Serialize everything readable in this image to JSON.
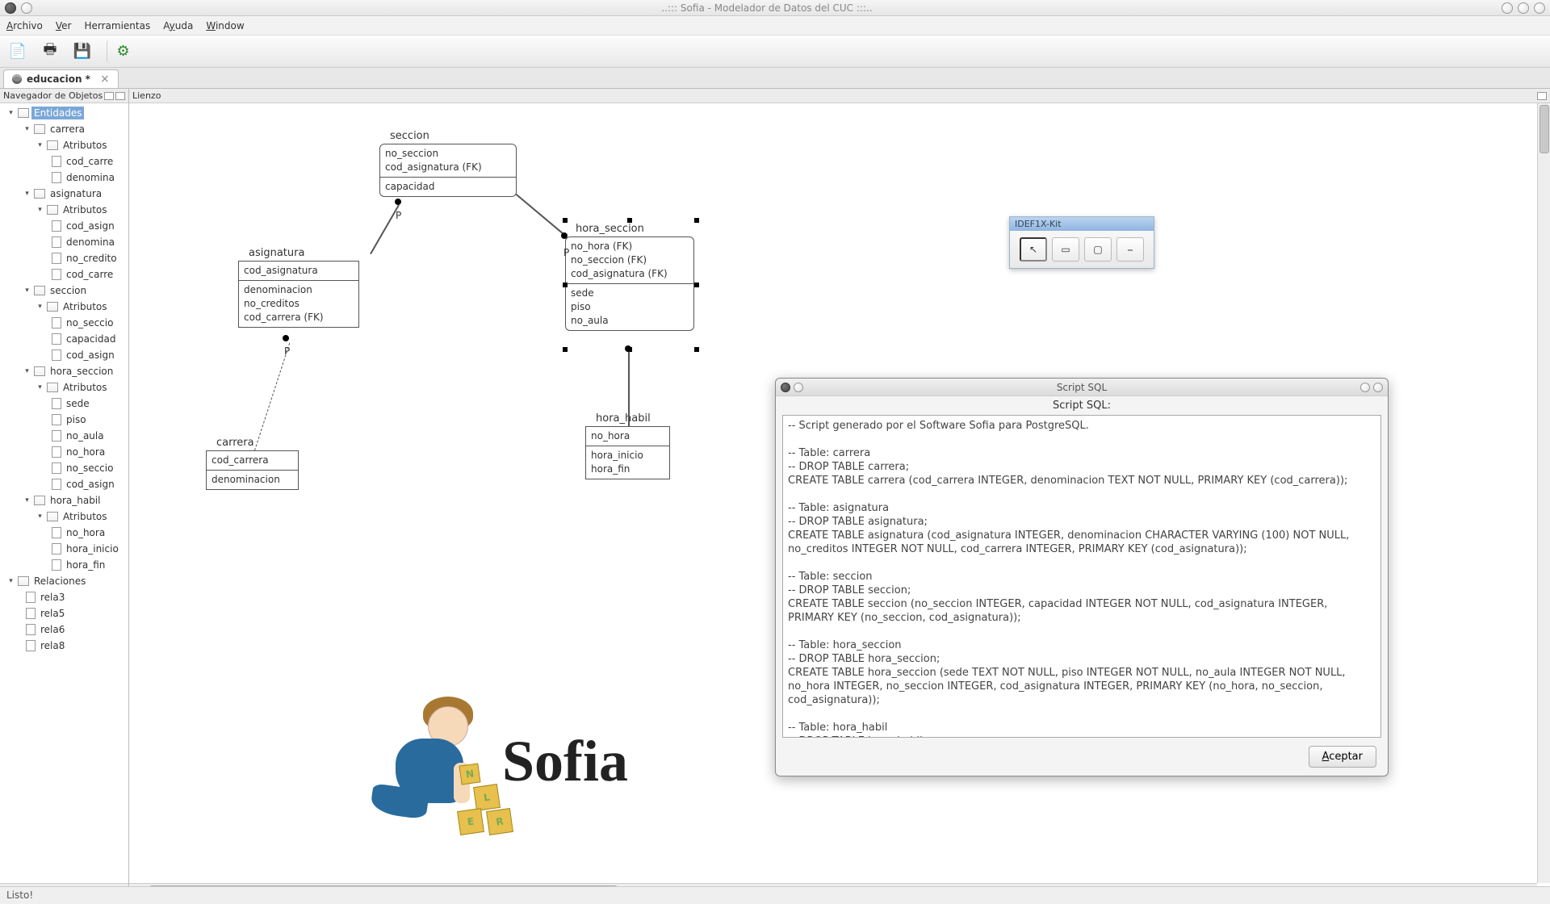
{
  "window": {
    "title": "..::: Sofia - Modelador de Datos del CUC :::.."
  },
  "menu": {
    "archivo": "Archivo",
    "ver": "Ver",
    "herramientas": "Herramientas",
    "ayuda": "Ayuda",
    "window": "Window"
  },
  "tab": {
    "label": "educacion *"
  },
  "panes": {
    "navigator": "Navegador de Objetos",
    "canvas": "Lienzo"
  },
  "tree": {
    "entidades": "Entidades",
    "carrera": "carrera",
    "atributos": "Atributos",
    "cod_carre": "cod_carre",
    "denomina": "denomina",
    "asignatura": "asignatura",
    "cod_asign": "cod_asign",
    "no_credito": "no_credito",
    "seccion": "seccion",
    "no_seccio": "no_seccio",
    "capacidad": "capacidad",
    "hora_seccion": "hora_seccion",
    "sede": "sede",
    "piso": "piso",
    "no_aula": "no_aula",
    "no_hora": "no_hora",
    "hora_habil": "hora_habil",
    "hora_inicio": "hora_inicio",
    "hora_fin": "hora_fin",
    "relaciones": "Relaciones",
    "rela3": "rela3",
    "rela5": "rela5",
    "rela6": "rela6",
    "rela8": "rela8"
  },
  "entities": {
    "seccion": {
      "title": "seccion",
      "pk": [
        "no_seccion",
        "cod_asignatura (FK)"
      ],
      "attrs": [
        "capacidad"
      ]
    },
    "asignatura": {
      "title": "asignatura",
      "pk": [
        "cod_asignatura"
      ],
      "attrs": [
        "denominacion",
        "no_creditos",
        "cod_carrera (FK)"
      ]
    },
    "hora_seccion": {
      "title": "hora_seccion",
      "pk": [
        "no_hora (FK)",
        "no_seccion (FK)",
        "cod_asignatura (FK)"
      ],
      "attrs": [
        "sede",
        "piso",
        "no_aula"
      ]
    },
    "carrera": {
      "title": "carrera",
      "pk": [
        "cod_carrera"
      ],
      "attrs": [
        "denominacion"
      ]
    },
    "hora_habil": {
      "title": "hora_habil",
      "pk": [
        "no_hora"
      ],
      "attrs": [
        "hora_inicio",
        "hora_fin"
      ]
    }
  },
  "rel_p": "P",
  "palette": {
    "title": "IDEF1X-Kit"
  },
  "dialog": {
    "title": "Script SQL",
    "label": "Script SQL:",
    "accept": "Aceptar",
    "sql": "-- Script generado por el Software Sofia para PostgreSQL.\n\n-- Table: carrera\n-- DROP TABLE carrera;\nCREATE TABLE carrera (cod_carrera INTEGER, denominacion TEXT NOT NULL, PRIMARY KEY (cod_carrera));\n\n-- Table: asignatura\n-- DROP TABLE asignatura;\nCREATE TABLE asignatura (cod_asignatura INTEGER, denominacion CHARACTER VARYING (100) NOT NULL, no_creditos INTEGER NOT NULL, cod_carrera INTEGER, PRIMARY KEY (cod_asignatura));\n\n-- Table: seccion\n-- DROP TABLE seccion;\nCREATE TABLE seccion (no_seccion INTEGER, capacidad INTEGER NOT NULL, cod_asignatura INTEGER, PRIMARY KEY (no_seccion, cod_asignatura));\n\n-- Table: hora_seccion\n-- DROP TABLE hora_seccion;\nCREATE TABLE hora_seccion (sede TEXT NOT NULL, piso INTEGER NOT NULL, no_aula INTEGER NOT NULL, no_hora INTEGER, no_seccion INTEGER, cod_asignatura INTEGER, PRIMARY KEY (no_hora, no_seccion, cod_asignatura));\n\n-- Table: hora_habil\n-- DROP TABLE hora_habil;\nCREATE TABLE hora_habil (no_hora INTEGER, hora_inicio TIME WITHOUT TIME ZONE NOT NULL, hora_fin TIME"
  },
  "logo": {
    "text": "Sofia"
  },
  "status": {
    "text": "Listo!"
  }
}
